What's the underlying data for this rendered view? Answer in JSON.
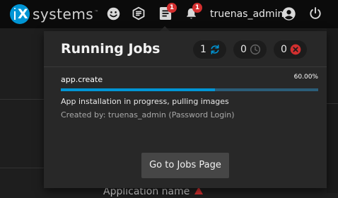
{
  "topbar": {
    "logo_text": "systems",
    "logo_tm": "™",
    "icons": [
      "feedback-icon",
      "truecommand-icon",
      "jobs-icon",
      "notifications-icon",
      "account-icon",
      "power-icon"
    ],
    "jobs_badge": "1",
    "notifications_badge": "1",
    "username": "truenas_admin"
  },
  "panel": {
    "title": "Running Jobs",
    "counters": [
      {
        "count": "1",
        "icon": "running-icon",
        "color": "#0095d5"
      },
      {
        "count": "0",
        "icon": "waiting-icon",
        "color": "#666666"
      },
      {
        "count": "0",
        "icon": "failed-icon",
        "color": "#d32f2f"
      }
    ],
    "job": {
      "name": "app.create",
      "percent_text": "60.00%",
      "progress": 0.6,
      "description": "App installation in progress, pulling images",
      "created_by": "Created by: truenas_admin (Password Login)"
    },
    "button_label": "Go to Jobs Page"
  },
  "background": {
    "field_label": "Application name"
  },
  "colors": {
    "accent": "#0095d5",
    "badge": "#d32f2f",
    "panel_bg": "#282828",
    "topbar_bg": "#0b0b0b"
  }
}
